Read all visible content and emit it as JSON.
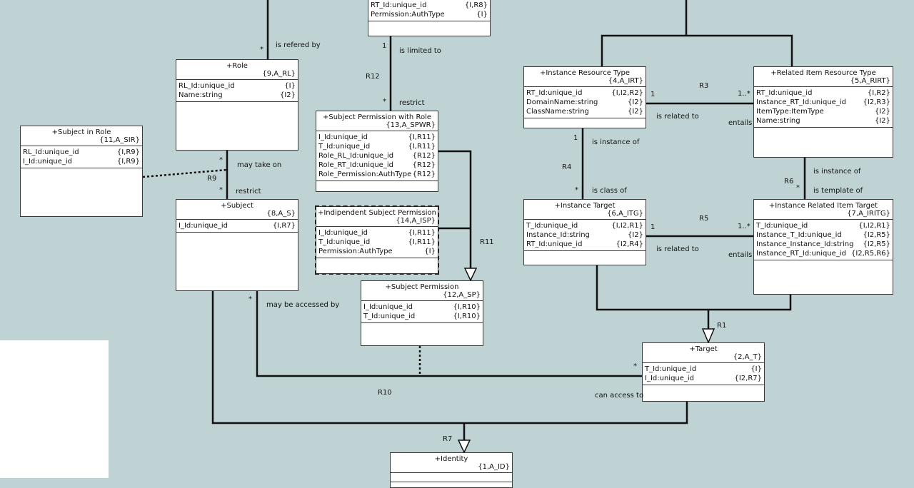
{
  "classes": [
    {
      "key": "rt-top",
      "name": "",
      "id": "",
      "attrs": [
        {
          "name": "RT_Id:unique_id",
          "ref": "{I,R8}"
        },
        {
          "name": "Permission:AuthType",
          "ref": "{I}"
        }
      ]
    },
    {
      "key": "role",
      "name": "+Role",
      "id": "{9,A_RL}",
      "attrs": [
        {
          "name": "RL_Id:unique_id",
          "ref": "{I}"
        },
        {
          "name": "Name:string",
          "ref": "{I2}"
        }
      ]
    },
    {
      "key": "subject-permission-with-role",
      "name": "+Subject Permission with Role",
      "id": "{13,A_SPWR}",
      "attrs": [
        {
          "name": "I_Id:unique_id",
          "ref": "{I,R11}"
        },
        {
          "name": "T_Id:unique_id",
          "ref": "{I,R11}"
        },
        {
          "name": "Role_RL_Id:unique_id",
          "ref": "{R12}"
        },
        {
          "name": "Role_RT_Id:unique_id",
          "ref": "{R12}"
        },
        {
          "name": "Role_Permission:AuthType",
          "ref": "{R12}"
        }
      ]
    },
    {
      "key": "subject-in-role",
      "name": "+Subject in Role",
      "id": "{11,A_SIR}",
      "attrs": [
        {
          "name": "RL_Id:unique_id",
          "ref": "{I,R9}"
        },
        {
          "name": "I_Id:unique_id",
          "ref": "{I,R9}"
        }
      ]
    },
    {
      "key": "subject",
      "name": "+Subject",
      "id": "{8,A_S}",
      "attrs": [
        {
          "name": "I_Id:unique_id",
          "ref": "{I,R7}"
        }
      ]
    },
    {
      "key": "independent-subject-permission",
      "name": "+Indipendent Subject Permission",
      "id": "{14,A_ISP}",
      "attrs": [
        {
          "name": "I_Id:unique_id",
          "ref": "{I,R11}"
        },
        {
          "name": "T_Id:unique_id",
          "ref": "{I,R11}"
        },
        {
          "name": "Permission:AuthType",
          "ref": "{I}"
        }
      ]
    },
    {
      "key": "subject-permission",
      "name": "+Subject Permission",
      "id": "{12,A_SP}",
      "attrs": [
        {
          "name": "I_Id:unique_id",
          "ref": "{I,R10}"
        },
        {
          "name": "T_Id:unique_id",
          "ref": "{I,R10}"
        }
      ]
    },
    {
      "key": "instance-resource-type",
      "name": "+Instance Resource Type",
      "id": "{4,A_IRT}",
      "attrs": [
        {
          "name": "RT_Id:unique_id",
          "ref": "{I,I2,R2}"
        },
        {
          "name": "DomainName:string",
          "ref": "{I2}"
        },
        {
          "name": "ClassName:string",
          "ref": "{I2}"
        }
      ]
    },
    {
      "key": "related-item-resource-type",
      "name": "+Related Item Resource Type",
      "id": "{5,A_RIRT}",
      "attrs": [
        {
          "name": "RT_Id:unique_id",
          "ref": "{I,R2}"
        },
        {
          "name": "Instance_RT_Id:unique_id",
          "ref": "{I2,R3}"
        },
        {
          "name": "ItemType:ItemType",
          "ref": "{I2}"
        },
        {
          "name": "Name:string",
          "ref": "{I2}"
        }
      ]
    },
    {
      "key": "instance-target",
      "name": "+Instance Target",
      "id": "{6,A_ITG}",
      "attrs": [
        {
          "name": "T_Id:unique_id",
          "ref": "{I,I2,R1}"
        },
        {
          "name": "Instance_Id:string",
          "ref": "{I2}"
        },
        {
          "name": "RT_Id:unique_id",
          "ref": "{I2,R4}"
        }
      ]
    },
    {
      "key": "instance-related-item-target",
      "name": "+Instance Related Item Target",
      "id": "{7,A_IRITG}",
      "attrs": [
        {
          "name": "T_Id:unique_id",
          "ref": "{I,I2,R1}"
        },
        {
          "name": "Instance_T_Id:unique_id",
          "ref": "{I2,R5}"
        },
        {
          "name": "Instance_Instance_Id:string",
          "ref": "{I2,R5}"
        },
        {
          "name": "Instance_RT_Id:unique_id",
          "ref": "{I2,R5,R6}"
        }
      ]
    },
    {
      "key": "target",
      "name": "+Target",
      "id": "{2,A_T}",
      "attrs": [
        {
          "name": "T_Id:unique_id",
          "ref": "{I}"
        },
        {
          "name": "I_Id:unique_id",
          "ref": "{I2,R7}"
        }
      ]
    },
    {
      "key": "identity",
      "name": "+Identity",
      "id": "{1,A_ID}",
      "attrs": []
    }
  ],
  "labels": {
    "is_refered_by": "is refered by",
    "mult_role_top": "*",
    "is_limited_to": "is limited to",
    "one_r12": "1",
    "r12": "R12",
    "restrict_spwr": "restrict",
    "mult_spwr": "*",
    "may_take_on": "may take on",
    "mult_role_bottom": "*",
    "r9": "R9",
    "mult_subject_top": "*",
    "restrict_subject": "restrict",
    "r11": "R11",
    "may_be_accessed_by": "may be accessed by",
    "mult_subject_bottom": "*",
    "r10": "R10",
    "r3": "R3",
    "one_r3": "1",
    "many_r3": "1..*",
    "is_related_to_r3": "is related to",
    "entails_r3": "entails",
    "one_r4": "1",
    "is_instance_of_r4": "is instance of",
    "r4": "R4",
    "mult_r4": "*",
    "is_class_of": "is class of",
    "is_instance_of_r6": "is instance of",
    "r6": "R6",
    "mult_r6": "*",
    "is_template_of": "is template of",
    "r5": "R5",
    "one_r5": "1",
    "many_r5": "1..*",
    "is_related_to_r5": "is related to",
    "entails_r5": "entails",
    "r1": "R1",
    "mult_target": "*",
    "can_access_to": "can access to",
    "r7": "R7"
  }
}
